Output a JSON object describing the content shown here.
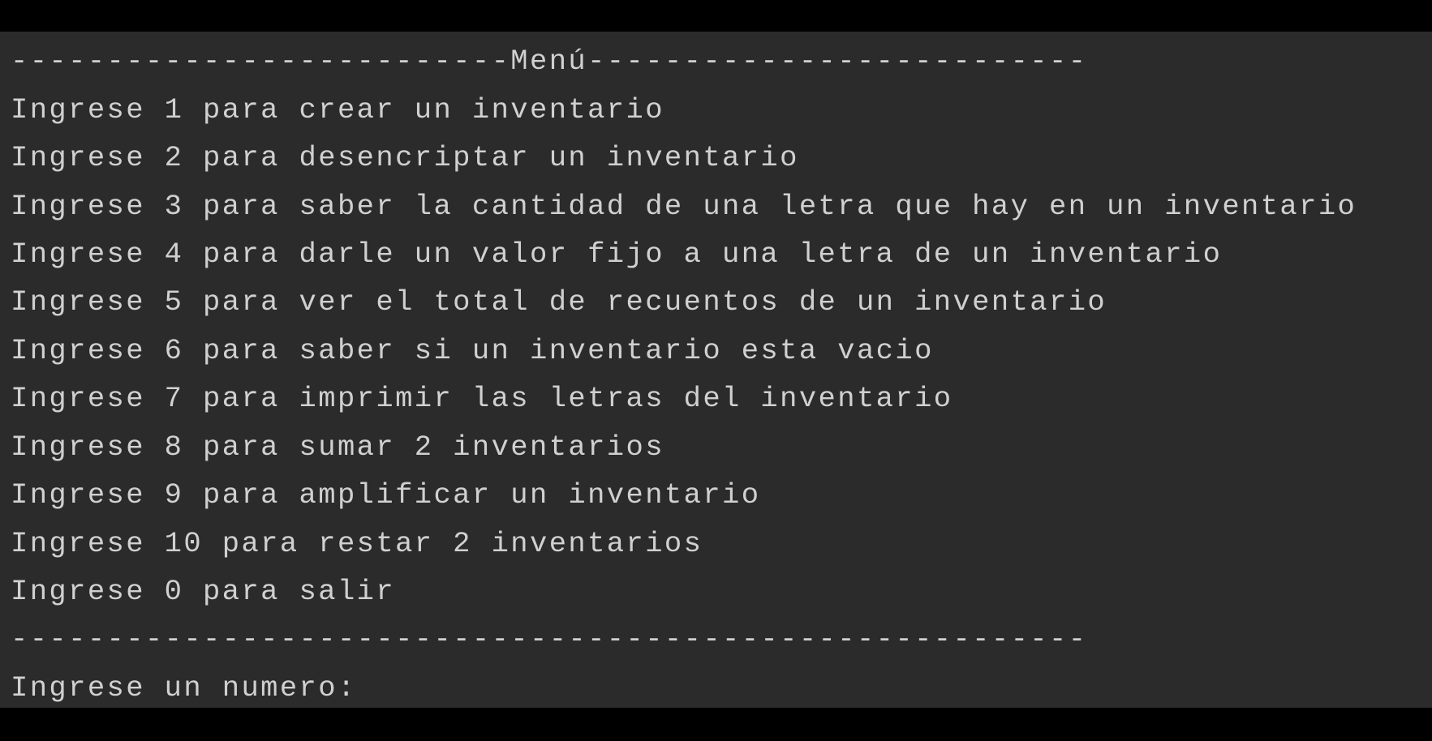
{
  "console": {
    "header_line": "--------------------------Menú--------------------------",
    "menu_lines": [
      "Ingrese 1 para crear un inventario",
      "Ingrese 2 para desencriptar un inventario",
      "Ingrese 3 para saber la cantidad de una letra que hay en un inventario",
      "Ingrese 4 para darle un valor fijo a una letra de un inventario",
      "Ingrese 5 para ver el total de recuentos de un inventario",
      "Ingrese 6 para saber si un inventario esta vacio",
      "Ingrese 7 para imprimir las letras del inventario",
      "Ingrese 8 para sumar 2 inventarios",
      "Ingrese 9 para amplificar un inventario",
      "Ingrese 10 para restar 2 inventarios",
      "Ingrese 0 para salir"
    ],
    "footer_line": "--------------------------------------------------------",
    "prompt": "Ingrese un numero:"
  },
  "colors": {
    "background": "#000000",
    "console_background": "#2b2b2b",
    "text": "#d0d0d0"
  }
}
